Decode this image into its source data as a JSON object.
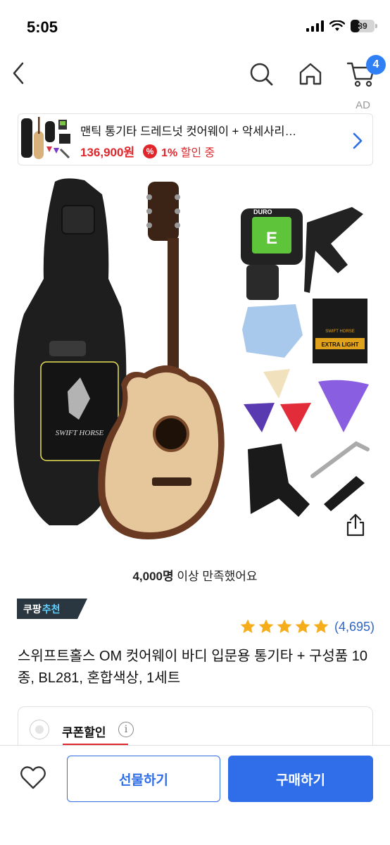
{
  "status_bar": {
    "time": "5:05",
    "battery": "39"
  },
  "nav": {
    "cart_count": "4"
  },
  "ad": {
    "label": "AD",
    "title": "맨틱 통기타 드레드넛 컷어웨이 + 악세사리…",
    "price": "136,900원",
    "discount_icon": "%",
    "discount_value": "1%",
    "discount_suffix": " 할인 중"
  },
  "image_labels": {
    "tuner_brand": "DURO",
    "tuner_note": "E",
    "bag_brand": "SWIFT HORSE",
    "strings_line1": "EXTRA LIGHT",
    "strings_brand": "SWIFT HORSE"
  },
  "product": {
    "satisfied_count": "4,000명",
    "satisfied_suffix": " 이상 만족했어요",
    "badge_brand": "쿠팡",
    "badge_accent": "추천",
    "rating_stars": 5,
    "review_count": "(4,695)",
    "title": "스위프트홀스 OM 컷어웨이 바디 입문용 통기타 + 구성품 10종, BL281, 혼합색상, 1세트"
  },
  "coupon": {
    "label": "쿠폰할인",
    "info_icon": "i"
  },
  "bottom": {
    "gift_label": "선물하기",
    "buy_label": "구매하기"
  },
  "colors": {
    "accent_blue": "#2f6ee8",
    "price_red": "#e0262b",
    "star": "#f6ad1c",
    "badge_bg": "#2a3740"
  },
  "icons": [
    "back-chevron-icon",
    "search-icon",
    "home-icon",
    "cart-icon",
    "chevron-right-icon",
    "share-icon",
    "star-icon",
    "info-icon",
    "heart-icon"
  ]
}
